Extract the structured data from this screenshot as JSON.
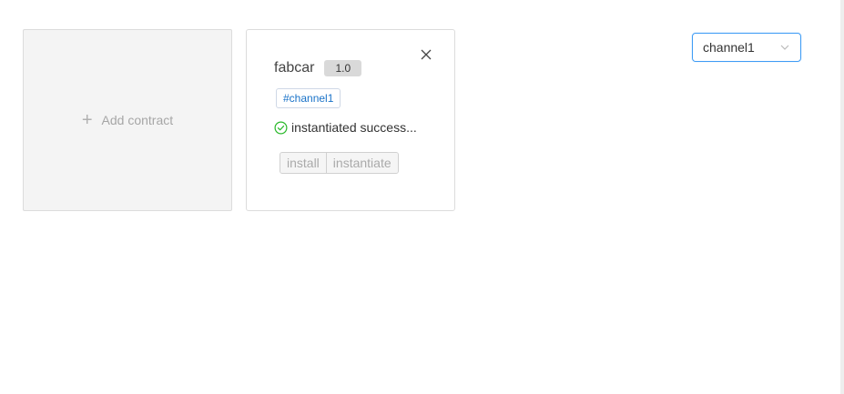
{
  "add_card": {
    "label": "Add contract"
  },
  "contract": {
    "name": "fabcar",
    "version": "1.0",
    "channel_tag": "#channel1",
    "status": "instantiated success...",
    "actions": {
      "install_label": "install",
      "instantiate_label": "instantiate"
    }
  },
  "channel_select": {
    "value": "channel1"
  },
  "icons": {
    "plus": "plus-icon",
    "close": "close-icon",
    "status": "check-circle-icon",
    "select": "chevron-down-icon"
  },
  "colors": {
    "accent": "#3f9cf5",
    "success": "#29b82a",
    "tag_text": "#1a73c8"
  }
}
